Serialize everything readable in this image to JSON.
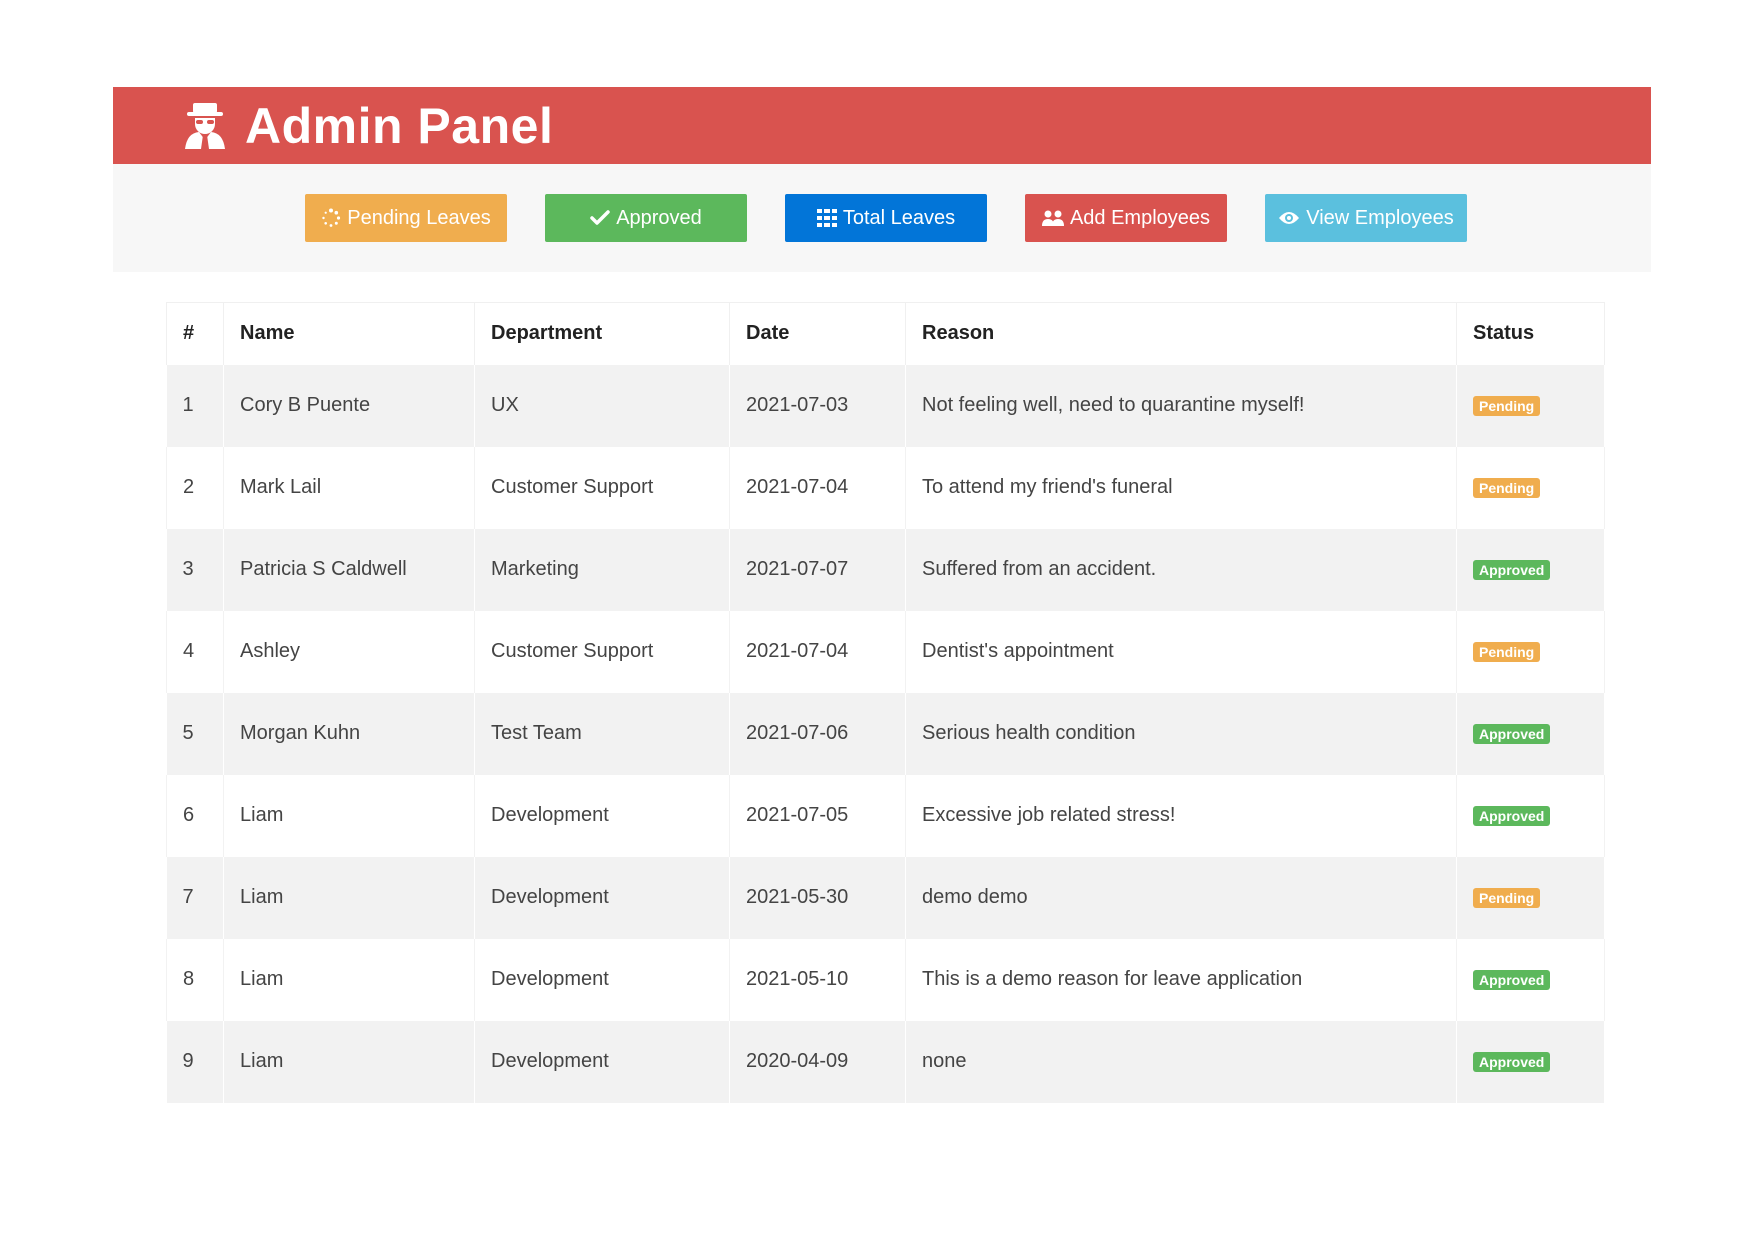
{
  "header": {
    "title": "Admin Panel",
    "icon": "user-secret-icon",
    "color": "#d9534f"
  },
  "toolbar": {
    "buttons": [
      {
        "label": "Pending Leaves",
        "icon": "spinner-icon",
        "color": "#f0ad4e"
      },
      {
        "label": "Approved",
        "icon": "check-icon",
        "color": "#5cb85c"
      },
      {
        "label": "Total Leaves",
        "icon": "grid-icon",
        "color": "#0275d8"
      },
      {
        "label": "Add Employees",
        "icon": "users-icon",
        "color": "#d9534f"
      },
      {
        "label": "View Employees",
        "icon": "eye-icon",
        "color": "#5bc0de"
      }
    ]
  },
  "table": {
    "columns": [
      "#",
      "Name",
      "Department",
      "Date",
      "Reason",
      "Status"
    ],
    "rows": [
      {
        "num": "1",
        "name": "Cory B Puente",
        "department": "UX",
        "date": "2021-07-03",
        "reason": "Not feeling well, need to quarantine myself!",
        "status": "Pending"
      },
      {
        "num": "2",
        "name": "Mark Lail",
        "department": "Customer Support",
        "date": "2021-07-04",
        "reason": "To attend my friend's funeral",
        "status": "Pending"
      },
      {
        "num": "3",
        "name": "Patricia S Caldwell",
        "department": "Marketing",
        "date": "2021-07-07",
        "reason": "Suffered from an accident.",
        "status": "Approved"
      },
      {
        "num": "4",
        "name": "Ashley",
        "department": "Customer Support",
        "date": "2021-07-04",
        "reason": "Dentist's appointment",
        "status": "Pending"
      },
      {
        "num": "5",
        "name": "Morgan Kuhn",
        "department": "Test Team",
        "date": "2021-07-06",
        "reason": "Serious health condition",
        "status": "Approved"
      },
      {
        "num": "6",
        "name": "Liam",
        "department": "Development",
        "date": "2021-07-05",
        "reason": "Excessive job related stress!",
        "status": "Approved"
      },
      {
        "num": "7",
        "name": "Liam",
        "department": "Development",
        "date": "2021-05-30",
        "reason": "demo demo",
        "status": "Pending"
      },
      {
        "num": "8",
        "name": "Liam",
        "department": "Development",
        "date": "2021-05-10",
        "reason": "This is a demo reason for leave application",
        "status": "Approved"
      },
      {
        "num": "9",
        "name": "Liam",
        "department": "Development",
        "date": "2020-04-09",
        "reason": "none",
        "status": "Approved"
      }
    ]
  }
}
